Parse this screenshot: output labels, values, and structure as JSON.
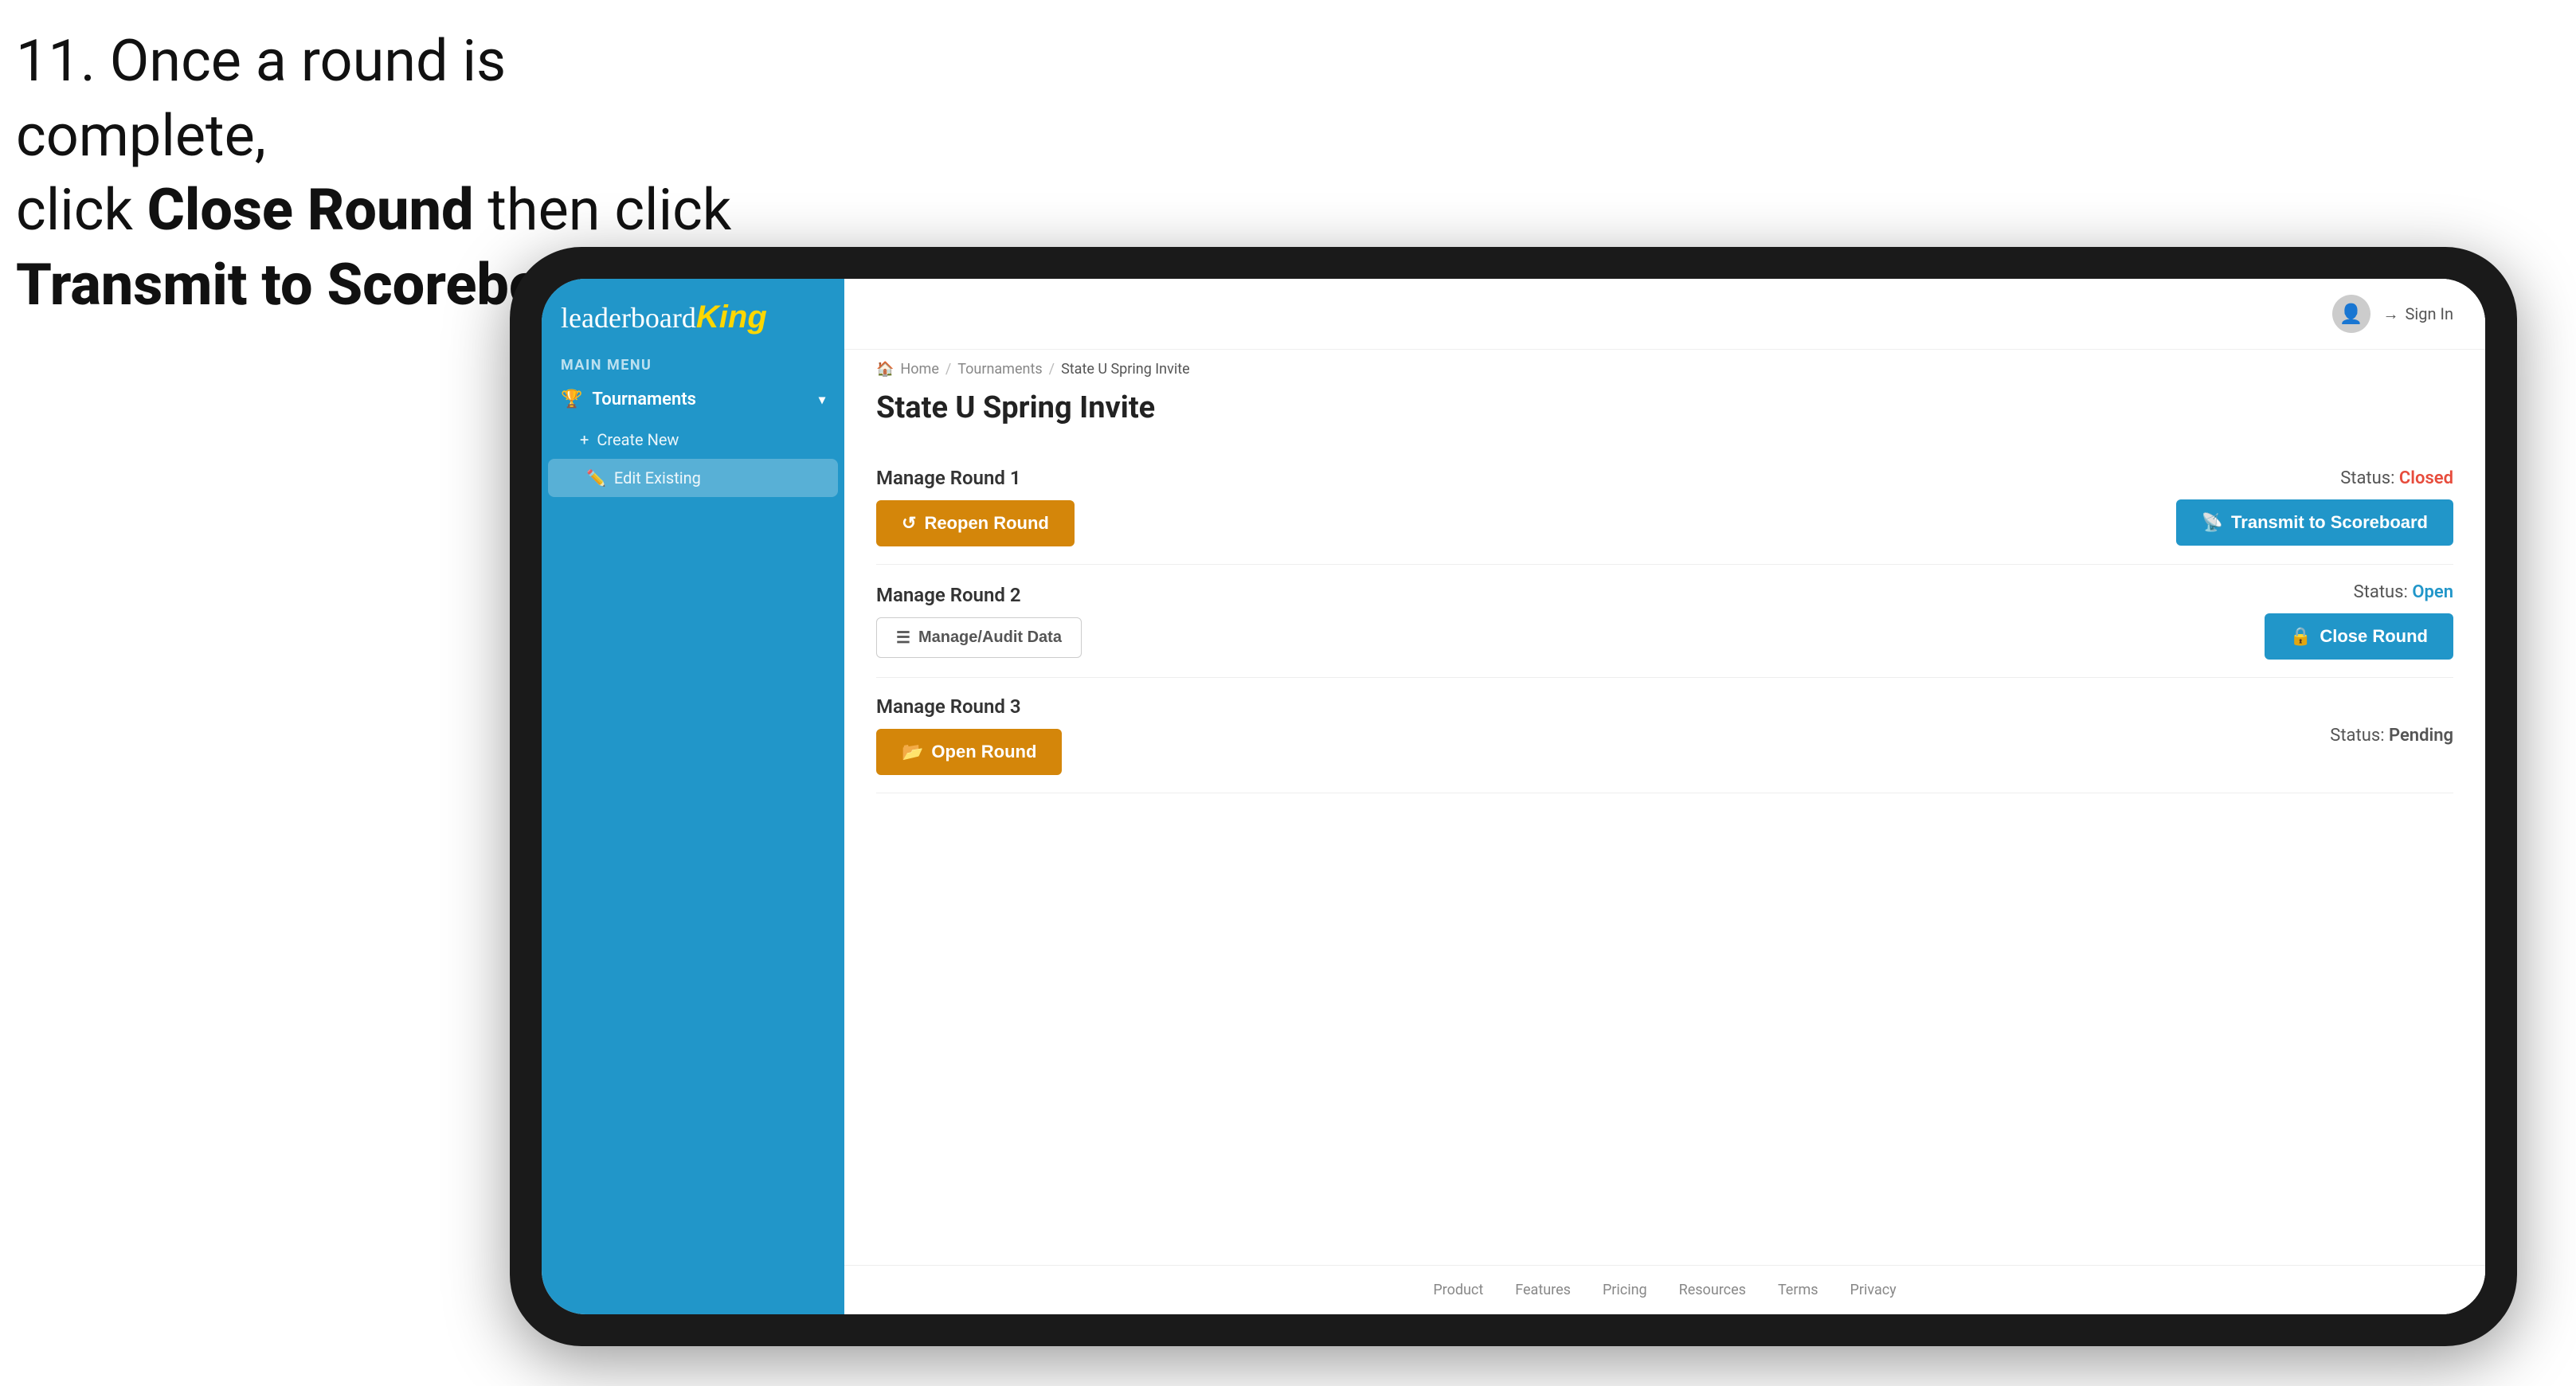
{
  "instruction": {
    "line1": "11. Once a round is complete,",
    "line2_prefix": "click ",
    "line2_bold1": "Close Round",
    "line2_suffix": " then click",
    "line3_bold": "Transmit to Scoreboard."
  },
  "sidebar": {
    "logo_leaderboard": "leaderboard",
    "logo_king": "King",
    "main_menu_label": "MAIN MENU",
    "tournaments_label": "Tournaments",
    "create_new_label": "Create New",
    "edit_existing_label": "Edit Existing"
  },
  "topbar": {
    "sign_in_label": "Sign In"
  },
  "breadcrumb": {
    "home": "Home",
    "tournaments": "Tournaments",
    "current": "State U Spring Invite"
  },
  "page": {
    "title": "State U Spring Invite",
    "rounds": [
      {
        "id": "round1",
        "title": "Manage Round 1",
        "status_label": "Status:",
        "status_value": "Closed",
        "status_class": "status-closed",
        "left_button": "Reopen Round",
        "left_button_type": "amber",
        "right_button": "Transmit to Scoreboard",
        "right_button_type": "blue"
      },
      {
        "id": "round2",
        "title": "Manage Round 2",
        "status_label": "Status:",
        "status_value": "Open",
        "status_class": "status-open",
        "left_button": "Manage/Audit Data",
        "left_button_type": "outline",
        "right_button": "Close Round",
        "right_button_type": "blue"
      },
      {
        "id": "round3",
        "title": "Manage Round 3",
        "status_label": "Status:",
        "status_value": "Pending",
        "status_class": "status-pending",
        "left_button": "Open Round",
        "left_button_type": "amber",
        "right_button": null
      }
    ]
  },
  "footer": {
    "links": [
      "Product",
      "Features",
      "Pricing",
      "Resources",
      "Terms",
      "Privacy"
    ]
  }
}
